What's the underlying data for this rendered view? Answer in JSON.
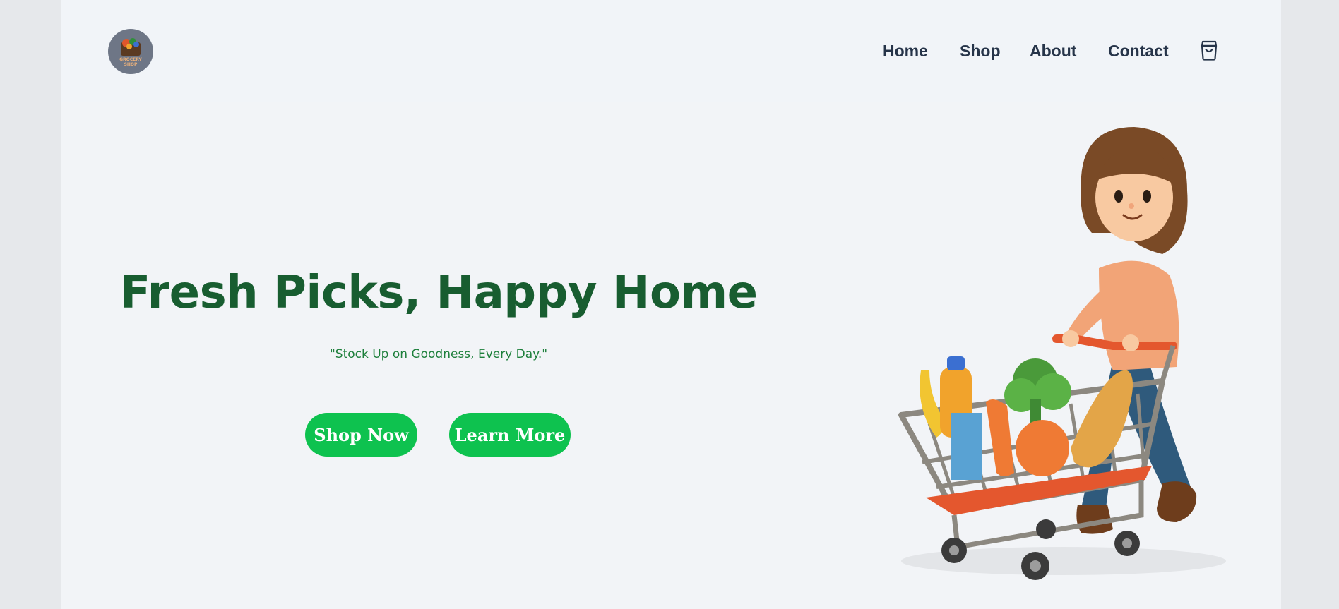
{
  "header": {
    "logo_text_line1": "GROCERY",
    "logo_text_line2": "SHOP",
    "nav": [
      {
        "label": "Home"
      },
      {
        "label": "Shop"
      },
      {
        "label": "About"
      },
      {
        "label": "Contact"
      }
    ],
    "cart_icon": "shopping-bag-icon"
  },
  "hero": {
    "title": "Fresh Picks, Happy Home",
    "subtitle": "\"Stock Up on Goodness, Every Day.\"",
    "buttons": [
      {
        "label": "Shop Now"
      },
      {
        "label": "Learn More"
      }
    ]
  },
  "colors": {
    "accent": "#0ec24f",
    "title": "#185d30",
    "nav_text": "#263449",
    "page_bg": "#f2f4f7"
  }
}
